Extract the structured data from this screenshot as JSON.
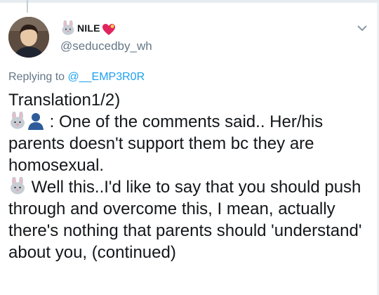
{
  "user": {
    "display_name": "NILE",
    "handle": "@seducedby_wh",
    "name_icons": [
      "rabbit-face-icon",
      "heart-icon"
    ]
  },
  "reply": {
    "prefix": "Replying to",
    "handle": "@__EMP3R0R"
  },
  "tweet": {
    "line1": "Translation1/2)",
    "line2_icons": [
      "rabbit-face-icon",
      "bust-silhouette-icon"
    ],
    "line2": ": One of the comments said.. Her/his parents doesn't support them bc they are homosexual.",
    "line3_icon": "rabbit-face-icon",
    "line3": "Well this..I'd like to say that you should push through and overcome this, I mean, actually there's nothing that parents should 'understand' about you, (continued)"
  },
  "colors": {
    "text": "#14171a",
    "secondary": "#657786",
    "link": "#1da1f2",
    "heart": "#e0245e"
  }
}
